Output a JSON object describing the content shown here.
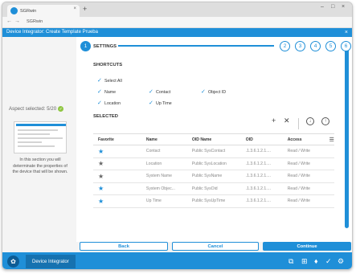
{
  "browser": {
    "tab_title": "SGRwin",
    "tab_close": "×",
    "new_tab": "+",
    "address": "SGRwin",
    "window_controls": {
      "minimize": "–",
      "maximize": "□",
      "close": "×"
    }
  },
  "app": {
    "title": "Device Integrator: Create Template Prueba",
    "close": "×",
    "accent_color": "#1f8fd8"
  },
  "left_panel": {
    "aspect_selected": "Aspect selected: 5/20",
    "help_text": "In this section you will determinate the properties of the device that will be shown."
  },
  "steps": {
    "active_number": "1",
    "active_label": "SETTINGS",
    "others": [
      "2",
      "3",
      "4",
      "5",
      "6"
    ]
  },
  "shortcuts": {
    "title": "SHORTCUTS",
    "select_all": "Select All",
    "items": [
      {
        "label": "Name",
        "checked": true
      },
      {
        "label": "Contact",
        "checked": true
      },
      {
        "label": "Object ID",
        "checked": true
      },
      {
        "label": "Location",
        "checked": true
      },
      {
        "label": "Up Time",
        "checked": true
      }
    ]
  },
  "selected": {
    "title": "SELECTED",
    "columns": [
      "Favorite",
      "Name",
      "OID Name",
      "OID",
      "Access"
    ],
    "rows": [
      {
        "favorite": true,
        "name": "Contact",
        "oid_name": "Public SysContact",
        "oid": ".1.3.6.1.2.1....",
        "access": "Read / Write"
      },
      {
        "favorite": false,
        "name": "Location",
        "oid_name": "Public SysLocation",
        "oid": ".1.3.6.1.2.1....",
        "access": "Read / Write"
      },
      {
        "favorite": false,
        "name": "System Name",
        "oid_name": "Public SysName",
        "oid": ".1.3.6.1.2.1....",
        "access": "Read / Write"
      },
      {
        "favorite": true,
        "name": "System Objec...",
        "oid_name": "Public SysOid",
        "oid": ".1.3.6.1.2.1....",
        "access": "Read / Write"
      },
      {
        "favorite": true,
        "name": "Up Time",
        "oid_name": "Public SysUpTime",
        "oid": ".1.3.6.1.2.1....",
        "access": "Read / Write"
      }
    ]
  },
  "buttons": {
    "back": "Back",
    "cancel": "Cancel",
    "continue": "Continue"
  },
  "bottom_bar": {
    "module": "Device Integrator"
  }
}
